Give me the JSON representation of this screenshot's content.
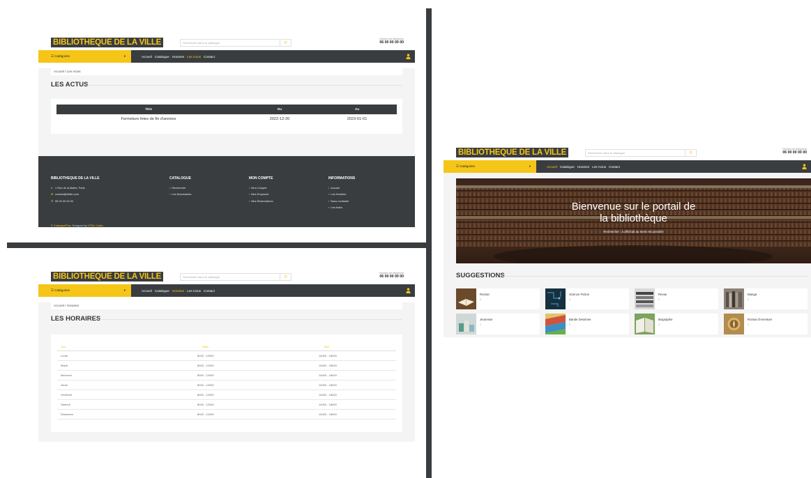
{
  "brand": "BIBLIOTHEQUE DE LA VILLE",
  "search": {
    "placeholder": "Rechercher dans le catalogue"
  },
  "phone": {
    "label": "Numéro de téléphone",
    "number": "06 00 00 00 00"
  },
  "nav": {
    "categories_label": "☰ Catégories",
    "links": [
      "Accueil",
      "Catalogue",
      "Horaires",
      "Les Actus",
      "Contact"
    ]
  },
  "actus_page": {
    "breadcrumb": "Accueil / Les Actus",
    "title": "LES ACTUS",
    "headers": [
      "Titre",
      "Du",
      "Au"
    ],
    "rows": [
      {
        "titre": "Fermeture fetes de fin d'années",
        "du": "2022-12-20",
        "au": "2023-01-01"
      }
    ]
  },
  "footer": {
    "col1": {
      "title": "BIBLIOTHEQUE DE LA VILLE",
      "items": [
        "1 Rue de la Mairie, Paris",
        "contact@biblio.com",
        "06 00 00 00 00"
      ]
    },
    "col2": {
      "title": "CATALOGUE",
      "items": [
        "Rechercher",
        "Les Nouveautés"
      ]
    },
    "col3": {
      "title": "MON COMPTE",
      "items": [
        "Mon Compte",
        "Mes Emprunts",
        "Mes Reservations"
      ]
    },
    "col4": {
      "title": "INFORMATIONS",
      "items": [
        "Accueil",
        "Les Horaires",
        "Nous contacter",
        "Les Actus"
      ]
    },
    "copyright_prefix": "© ",
    "copyright_brand": "CataloguePlus",
    "copyright_mid": ". Designed by ",
    "copyright_designer": "HTML Codex"
  },
  "horaires_page": {
    "breadcrumb": "Accueil / Horaires",
    "title": "LES HORAIRES",
    "headers": [
      "Jour",
      "Matin",
      "Midi"
    ],
    "rows": [
      {
        "jour": "Lundi",
        "matin": "8h00 - 12h00",
        "midi": "14h00 - 18h00"
      },
      {
        "jour": "Mardi",
        "matin": "8h00 - 12h00",
        "midi": "14h00 - 18h00"
      },
      {
        "jour": "Mercredi",
        "matin": "8h00 - 12h00",
        "midi": "14h00 - 18h00"
      },
      {
        "jour": "Jeudi",
        "matin": "8h00 - 12h00",
        "midi": "14h00 - 18h00"
      },
      {
        "jour": "Vendredi",
        "matin": "8h00 - 12h00",
        "midi": "14h00 - 18h00"
      },
      {
        "jour": "Samedi",
        "matin": "8h00 - 12h00",
        "midi": "14h00 - 18h00"
      },
      {
        "jour": "Dimanche",
        "matin": "8h00 - 12h00",
        "midi": "14h00 - 18h00"
      }
    ]
  },
  "home_page": {
    "hero_title_line1": "Bienvenue sur le portail de",
    "hero_title_line2": "la bibliothèque",
    "hero_subtitle": "Rechercher : à affichait au texte est possible",
    "suggestions_title": "SUGGESTIONS",
    "categories": [
      {
        "name": "Roman",
        "count": "0"
      },
      {
        "name": "Science Fiction",
        "count": "0"
      },
      {
        "name": "Revue",
        "count": "0"
      },
      {
        "name": "Manga",
        "count": "0"
      },
      {
        "name": "Jeunesse",
        "count": "0"
      },
      {
        "name": "Bande Dessinee",
        "count": "0"
      },
      {
        "name": "Biographie",
        "count": "0"
      },
      {
        "name": "Roman d'Aventure",
        "count": "0"
      }
    ]
  },
  "colors": {
    "accent": "#f5c518",
    "dark": "#3a3d40",
    "light_bg": "#f4f4f4"
  }
}
